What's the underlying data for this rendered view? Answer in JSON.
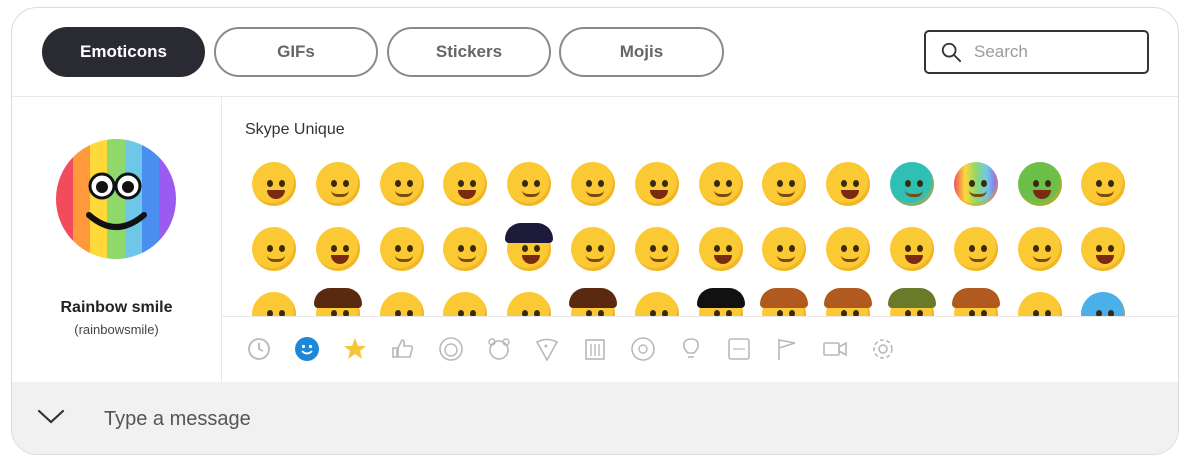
{
  "tabs": [
    {
      "label": "Emoticons",
      "active": true
    },
    {
      "label": "GIFs",
      "active": false
    },
    {
      "label": "Stickers",
      "active": false
    },
    {
      "label": "Mojis",
      "active": false
    }
  ],
  "search": {
    "placeholder": "Search"
  },
  "preview": {
    "name": "Rainbow smile",
    "code": "(rainbowsmile)",
    "stripes": [
      "#f24b5b",
      "#ff9a3c",
      "#ffd83a",
      "#8fd86a",
      "#6fc7e8",
      "#4a8ff0",
      "#9a5cf0"
    ]
  },
  "section": {
    "title": "Skype Unique"
  },
  "categories": [
    {
      "icon": "recent-clock-icon",
      "active": false
    },
    {
      "icon": "smiley-icon",
      "active": true
    },
    {
      "icon": "star-burst-icon",
      "active": false
    },
    {
      "icon": "thumbs-up-icon",
      "active": false
    },
    {
      "icon": "person-face-icon",
      "active": false
    },
    {
      "icon": "animal-icon",
      "active": false
    },
    {
      "icon": "food-pizza-icon",
      "active": false
    },
    {
      "icon": "building-icon",
      "active": false
    },
    {
      "icon": "sport-ball-icon",
      "active": false
    },
    {
      "icon": "lightbulb-icon",
      "active": false
    },
    {
      "icon": "symbols-icon",
      "active": false
    },
    {
      "icon": "flag-icon",
      "active": false
    },
    {
      "icon": "video-camera-icon",
      "active": false
    },
    {
      "icon": "settings-gear-icon",
      "active": false
    }
  ],
  "compose": {
    "placeholder": "Type a message"
  },
  "colors": {
    "accent": "#1e88d8",
    "active_tab": "#2a2a32"
  }
}
